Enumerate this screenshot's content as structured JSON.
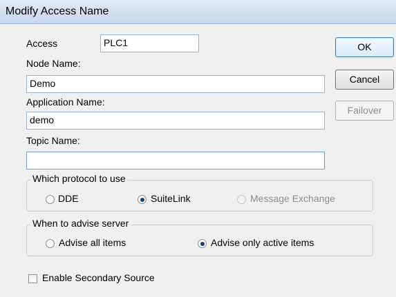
{
  "window": {
    "title": "Modify Access Name"
  },
  "fields": {
    "access": {
      "label": "Access",
      "value": "PLC1"
    },
    "node_name": {
      "label": "Node Name:",
      "value": "Demo"
    },
    "application_name": {
      "label": "Application Name:",
      "value": "demo"
    },
    "topic_name": {
      "label": "Topic Name:",
      "value": ""
    }
  },
  "buttons": {
    "ok": "OK",
    "cancel": "Cancel",
    "failover": "Failover"
  },
  "protocol": {
    "legend": "Which protocol to use",
    "options": [
      "DDE",
      "SuiteLink",
      "Message Exchange"
    ],
    "selected": "SuiteLink",
    "disabled": [
      "Message Exchange"
    ]
  },
  "advise": {
    "legend": "When to advise server",
    "options": [
      "Advise all items",
      "Advise only active items"
    ],
    "selected": "Advise only active items"
  },
  "secondary": {
    "label": "Enable Secondary Source",
    "checked": false
  }
}
